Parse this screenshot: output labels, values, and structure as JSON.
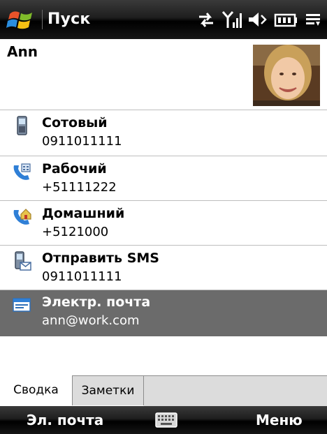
{
  "titlebar": {
    "title": "Пуск"
  },
  "contact": {
    "name": "Ann"
  },
  "rows": [
    {
      "label": "Сотовый",
      "value": "0911011111",
      "icon": "mobile-phone-icon"
    },
    {
      "label": "Рабочий",
      "value": "+51111222",
      "icon": "work-phone-icon"
    },
    {
      "label": "Домашний",
      "value": "+5121000",
      "icon": "home-phone-icon"
    },
    {
      "label": "Отправить SMS",
      "value": "0911011111",
      "icon": "sms-icon"
    },
    {
      "label": "Электр. почта",
      "value": "ann@work.com",
      "icon": "email-icon",
      "selected": true
    }
  ],
  "tabs": {
    "summary": "Сводка",
    "notes": "Заметки"
  },
  "softkeys": {
    "left": "Эл. почта",
    "right": "Меню"
  },
  "colors": {
    "selection": "#6b6b6b",
    "bar": "#000000",
    "tab_inactive": "#dcdcdc"
  }
}
